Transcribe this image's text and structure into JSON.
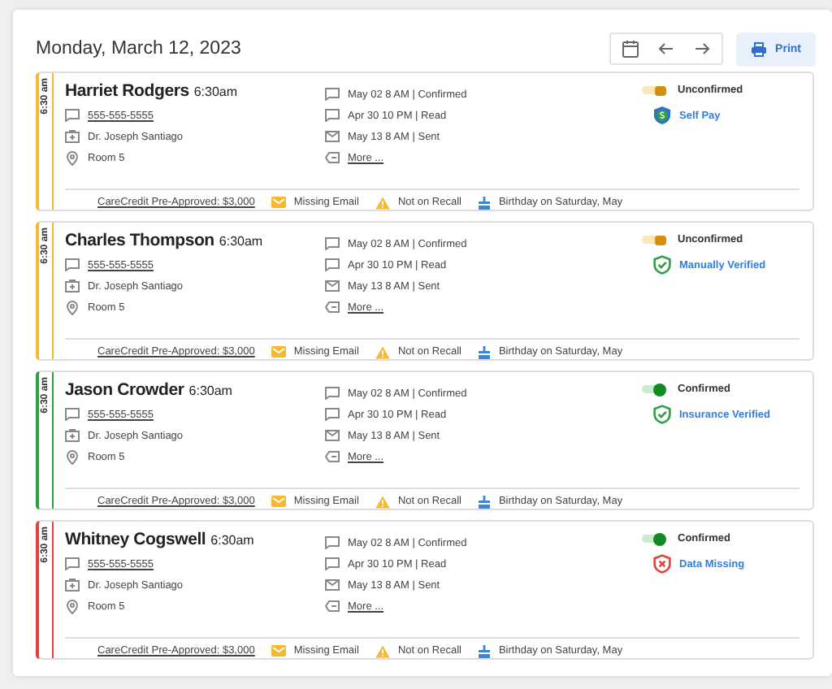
{
  "date_heading": "Monday, March 12, 2023",
  "print_button": "Print",
  "appointments": [
    {
      "time_tab": "6:30 am",
      "color": "#f5b82e",
      "name": "Harriet Rodgers",
      "time": "6:30am",
      "phone": "555-555-5555",
      "provider": "Dr. Joseph Santiago",
      "room": "Room 5",
      "messages": [
        "May 02 8 AM | Confirmed",
        "Apr 30 10 PM | Read",
        "May 13 8 AM | Sent"
      ],
      "more": "More ...",
      "confirmed": false,
      "status": "Unconfirmed",
      "badge": {
        "kind": "self-pay",
        "label": "Self Pay"
      },
      "footer": {
        "credit": "CareCredit Pre-Approved: $3,000",
        "email": "Missing Email",
        "recall": "Not on Recall",
        "birthday": "Birthday on Saturday, May"
      }
    },
    {
      "time_tab": "6:30 am",
      "color": "#f5b82e",
      "name": "Charles Thompson",
      "time": "6:30am",
      "phone": "555-555-5555",
      "provider": "Dr. Joseph Santiago",
      "room": "Room 5",
      "messages": [
        "May 02 8 AM | Confirmed",
        "Apr 30 10 PM | Read",
        "May 13 8 AM | Sent"
      ],
      "more": "More ...",
      "confirmed": false,
      "status": "Unconfirmed",
      "badge": {
        "kind": "verified",
        "label": "Manually Verified"
      },
      "footer": {
        "credit": "CareCredit Pre-Approved: $3,000",
        "email": "Missing Email",
        "recall": "Not on Recall",
        "birthday": "Birthday on Saturday, May"
      }
    },
    {
      "time_tab": "6:30 am",
      "color": "#2ea043",
      "name": "Jason Crowder",
      "time": "6:30am",
      "phone": "555-555-5555",
      "provider": "Dr. Joseph Santiago",
      "room": "Room 5",
      "messages": [
        "May 02 8 AM | Confirmed",
        "Apr 30 10 PM | Read",
        "May 13 8 AM | Sent"
      ],
      "more": "More ...",
      "confirmed": true,
      "status": "Confirmed",
      "badge": {
        "kind": "verified",
        "label": "Insurance Verified"
      },
      "footer": {
        "credit": "CareCredit Pre-Approved: $3,000",
        "email": "Missing Email",
        "recall": "Not on Recall",
        "birthday": "Birthday on Saturday, May"
      }
    },
    {
      "time_tab": "6:30 am",
      "color": "#e5413b",
      "name": "Whitney Cogswell",
      "time": "6:30am",
      "phone": "555-555-5555",
      "provider": "Dr. Joseph Santiago",
      "room": "Room 5",
      "messages": [
        "May 02 8 AM | Confirmed",
        "Apr 30 10 PM | Read",
        "May 13 8 AM | Sent"
      ],
      "more": "More ...",
      "confirmed": true,
      "status": "Confirmed",
      "badge": {
        "kind": "missing",
        "label": "Data Missing"
      },
      "footer": {
        "credit": "CareCredit Pre-Approved: $3,000",
        "email": "Missing Email",
        "recall": "Not on Recall",
        "birthday": "Birthday on Saturday, May"
      }
    }
  ]
}
